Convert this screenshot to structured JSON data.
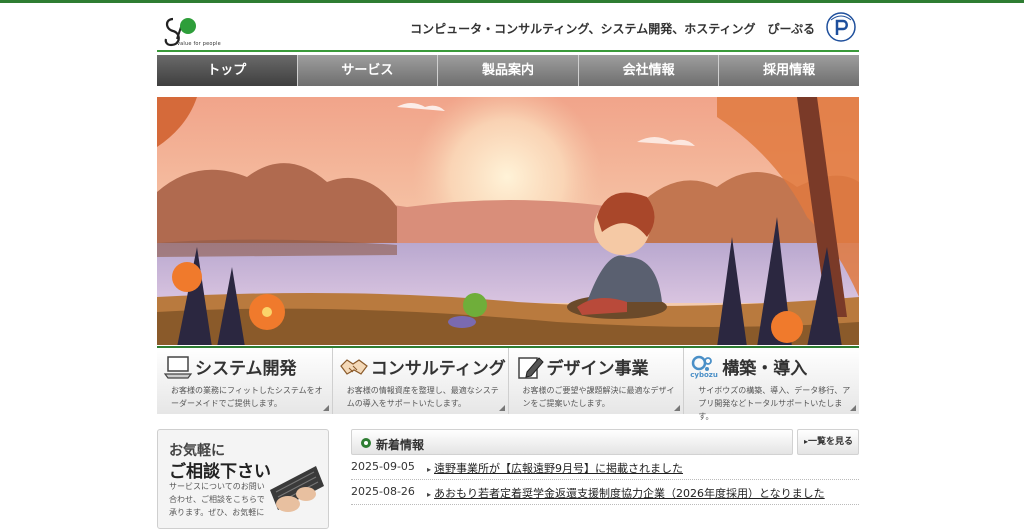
{
  "header": {
    "logo_tagline": "value for people",
    "tagline": "コンピュータ・コンサルティング、システム開発、ホスティング　ぴーぷる"
  },
  "nav": {
    "items": [
      {
        "label": "トップ"
      },
      {
        "label": "サービス"
      },
      {
        "label": "製品案内"
      },
      {
        "label": "会社情報"
      },
      {
        "label": "採用情報"
      }
    ]
  },
  "services": [
    {
      "title": "システム開発",
      "desc": "お客様の業務にフィットしたシステムをオーダーメイドでご提供します。",
      "icon": "laptop-icon"
    },
    {
      "title": "コンサルティング",
      "desc": "お客様の情報資産を整理し、最適なシステムの導入をサポートいたします。",
      "icon": "handshake-icon"
    },
    {
      "title": "デザイン事業",
      "desc": "お客様のご要望や課題解決に最適なデザインをご提案いたします。",
      "icon": "pencil-icon"
    },
    {
      "title": "構築・導入",
      "desc": "サイボウズの構築、導入、データ移行、アプリ開発などトータルサポートいたします。",
      "icon": "cybozu-icon",
      "brand": "cybozu"
    }
  ],
  "consult": {
    "line1": "お気軽に",
    "line2": "ご相談下さい",
    "body": "サービスについてのお問い合わせ、ご相談をこちらで承ります。ぜひ、お気軽に"
  },
  "news": {
    "title": "新着情報",
    "more_label": "一覧を見る",
    "items": [
      {
        "date": "2025-09-05",
        "text": "遠野事業所が【広報遠野9月号】に掲載されました"
      },
      {
        "date": "2025-08-26",
        "text": "あおもり若者定着奨学金返還支援制度協力企業（2026年度採用）となりました"
      }
    ]
  },
  "colors": {
    "accent_green": "#2e7d32",
    "nav_gray": "#7a7a7a",
    "nav_active": "#4a4a4a"
  }
}
